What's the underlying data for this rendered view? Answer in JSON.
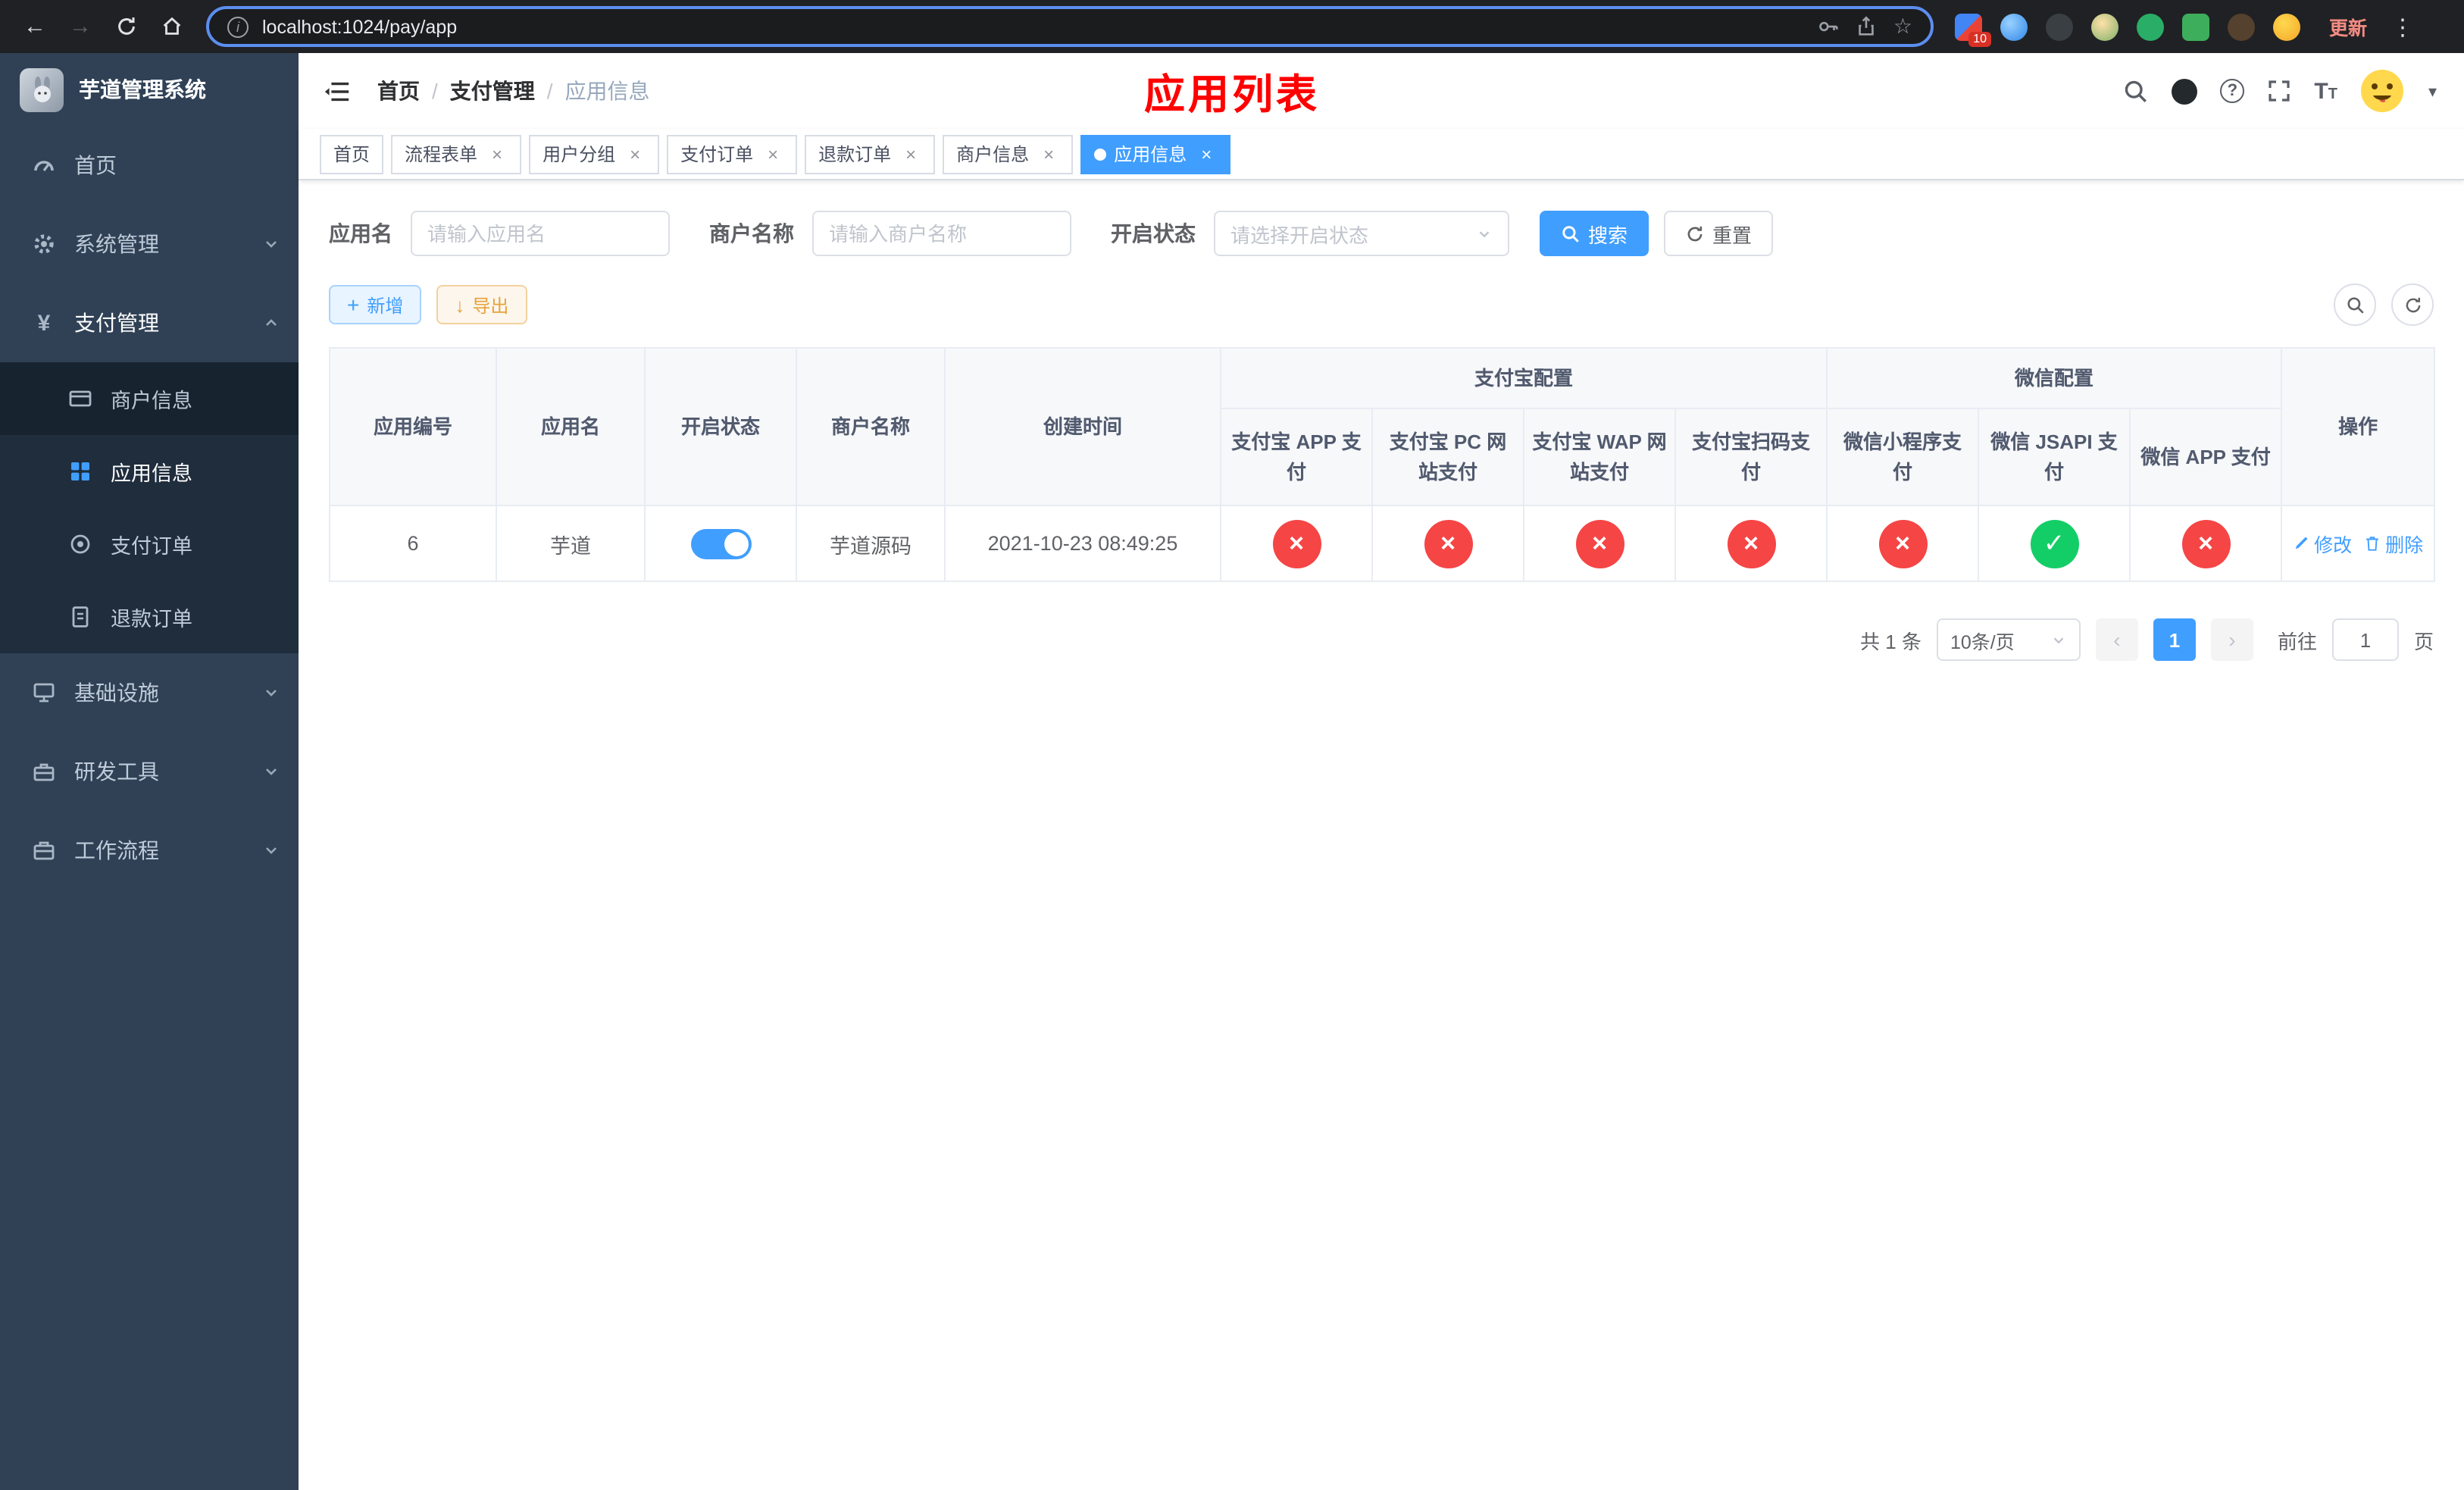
{
  "colors": {
    "accent": "#409eff",
    "danger": "#f54545",
    "success": "#13ce66",
    "warning": "#e6a23c",
    "titleRed": "#ff0000",
    "sidebarBg": "#304156",
    "submenuBg": "#1f2d3d"
  },
  "icons": {
    "cross": "×",
    "check": "✓",
    "yen": "¥",
    "star": "☆",
    "back": "←",
    "forward": "→",
    "menuDots": "⋮",
    "caretDown": "▾",
    "plus": "+",
    "arrowDown": "↓",
    "chevLeft": "‹",
    "chevRight": "›",
    "info": "i",
    "question": "?",
    "fontBig": "T",
    "fontSmall": "T"
  },
  "browser": {
    "url": "localhost:1024/pay/app",
    "updateLabel": "更新",
    "extensionBadge": "10"
  },
  "sidebar": {
    "title": "芋道管理系统",
    "items": [
      {
        "label": "首页"
      },
      {
        "label": "系统管理"
      },
      {
        "label": "支付管理"
      },
      {
        "label": "基础设施"
      },
      {
        "label": "研发工具"
      },
      {
        "label": "工作流程"
      }
    ],
    "paySubmenu": [
      {
        "label": "商户信息"
      },
      {
        "label": "应用信息"
      },
      {
        "label": "支付订单"
      },
      {
        "label": "退款订单"
      }
    ]
  },
  "navbar": {
    "breadcrumb": [
      {
        "label": "首页"
      },
      {
        "label": "支付管理"
      },
      {
        "label": "应用信息"
      }
    ],
    "separator": "/",
    "pageTitle": "应用列表"
  },
  "tabs": [
    {
      "label": "首页"
    },
    {
      "label": "流程表单"
    },
    {
      "label": "用户分组"
    },
    {
      "label": "支付订单"
    },
    {
      "label": "退款订单"
    },
    {
      "label": "商户信息"
    },
    {
      "label": "应用信息"
    }
  ],
  "filters": {
    "appNameLabel": "应用名",
    "appNamePlaceholder": "请输入应用名",
    "merchantLabel": "商户名称",
    "merchantPlaceholder": "请输入商户名称",
    "statusLabel": "开启状态",
    "statusPlaceholder": "请选择开启状态",
    "searchLabel": "搜索",
    "resetLabel": "重置"
  },
  "toolbar": {
    "addLabel": "新增",
    "exportLabel": "导出"
  },
  "table": {
    "headers": {
      "appId": "应用编号",
      "appName": "应用名",
      "status": "开启状态",
      "merchant": "商户名称",
      "created": "创建时间",
      "alipayGroup": "支付宝配置",
      "wechatGroup": "微信配置",
      "alipayApp": "支付宝 APP 支付",
      "alipayPc": "支付宝 PC 网站支付",
      "alipayWap": "支付宝 WAP 网站支付",
      "alipayQr": "支付宝扫码支付",
      "wechatMini": "微信小程序支付",
      "wechatJsapi": "微信 JSAPI 支付",
      "wechatApp": "微信 APP 支付",
      "actions": "操作"
    },
    "rows": [
      {
        "appId": "6",
        "appName": "芋道",
        "enabled": true,
        "merchant": "芋道源码",
        "created": "2021-10-23 08:49:25",
        "alipayApp": "disabled",
        "alipayPc": "disabled",
        "alipayWap": "disabled",
        "alipayQr": "disabled",
        "wechatMini": "disabled",
        "wechatJsapi": "enabled",
        "wechatApp": "disabled",
        "editLabel": "修改",
        "deleteLabel": "删除"
      }
    ]
  },
  "pagination": {
    "totalText": "共 1 条",
    "pageSize": "10条/页",
    "currentPage": "1",
    "gotoLabel": "前往",
    "gotoValue": "1",
    "pageSuffix": "页"
  }
}
